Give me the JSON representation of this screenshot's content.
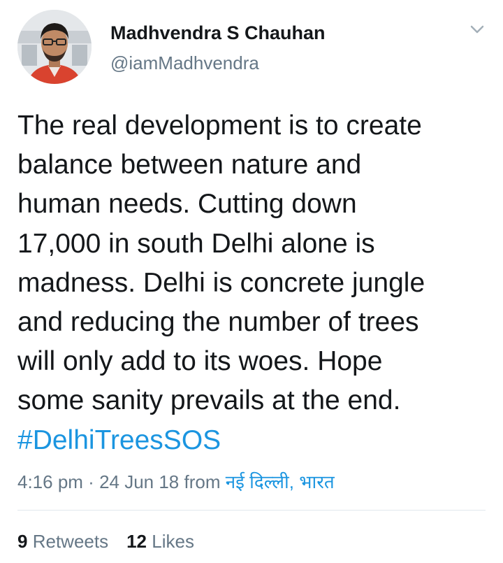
{
  "user": {
    "display_name": "Madhvendra S Chauhan",
    "handle": "@iamMadhvendra",
    "avatar": "profile-photo"
  },
  "menu_icon": "chevron-down-icon",
  "tweet": {
    "lines": [
      "The real development is to create",
      "balance between nature and",
      "human needs. Cutting down",
      "17,000 in south Delhi alone is",
      "madness. Delhi is concrete jungle",
      "and reducing the number of trees",
      "will only add to its woes. Hope",
      "some sanity prevails at the end."
    ],
    "hashtag": "#DelhiTreesSOS"
  },
  "meta": {
    "time": "4:16 pm",
    "separator": " · ",
    "date": "24 Jun 18",
    "from_label": " from ",
    "location": "नई दिल्ली, भारत"
  },
  "stats": {
    "retweets_count": "9",
    "retweets_label": "Retweets",
    "likes_count": "12",
    "likes_label": "Likes"
  },
  "colors": {
    "text": "#14171a",
    "secondary": "#657786",
    "link": "#1b95e0",
    "divider": "#e1e8ed"
  }
}
